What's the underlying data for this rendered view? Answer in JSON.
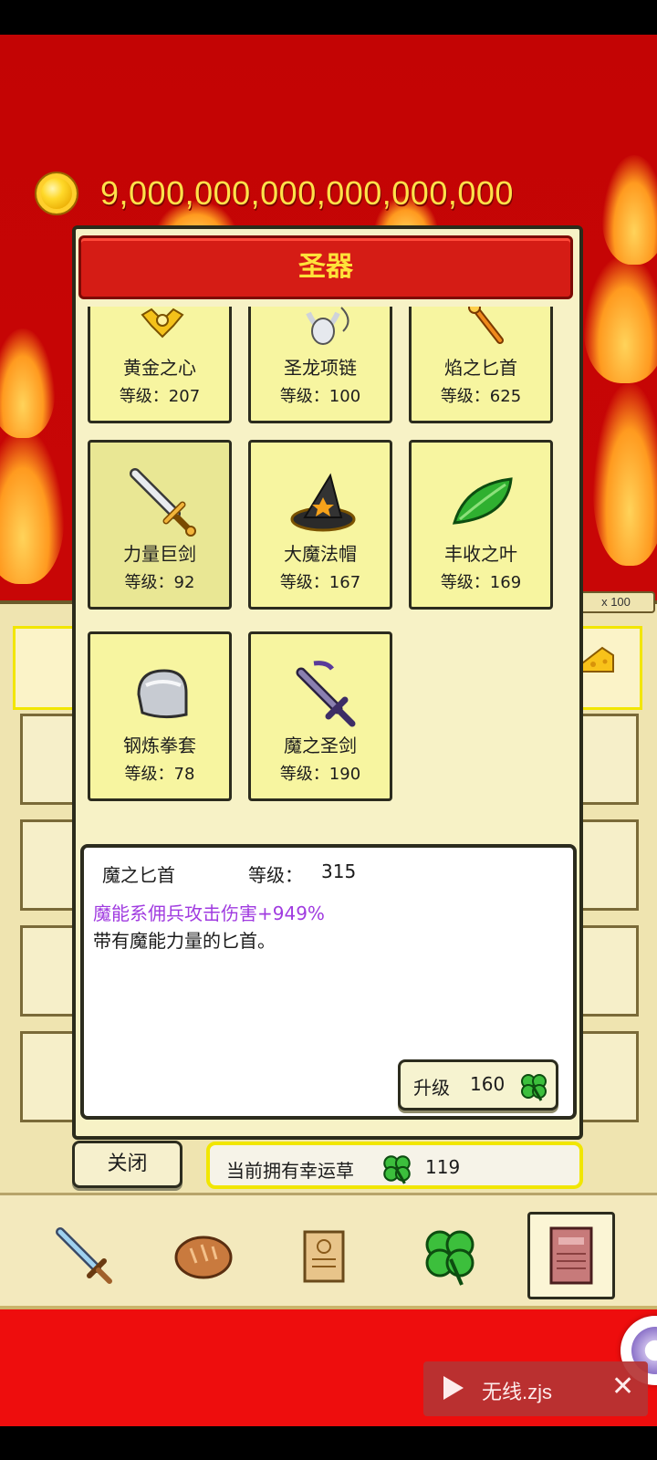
{
  "currency": {
    "amount": "9,000,000,000,000,000,000",
    "icon": "gold-coin-icon"
  },
  "dialog": {
    "title": "圣器",
    "items": [
      {
        "name": "黄金之心",
        "level": "等级：207",
        "icon": "golden-heart-icon"
      },
      {
        "name": "圣龙项链",
        "level": "等级：100",
        "icon": "dragon-necklace-icon"
      },
      {
        "name": "焰之匕首",
        "level": "等级：625",
        "icon": "flame-dagger-icon"
      },
      {
        "name": "力量巨剑",
        "level": "等级：92",
        "icon": "greatsword-icon"
      },
      {
        "name": "大魔法帽",
        "level": "等级：167",
        "icon": "wizard-hat-icon"
      },
      {
        "name": "丰收之叶",
        "level": "等级：169",
        "icon": "harvest-leaf-icon"
      },
      {
        "name": "钢炼拳套",
        "level": "等级：78",
        "icon": "steel-gauntlet-icon"
      },
      {
        "name": "魔之圣剑",
        "level": "等级：190",
        "icon": "demon-holy-sword-icon"
      }
    ],
    "detail": {
      "name": "魔之匕首",
      "level_label": "等级：",
      "level_value": "315",
      "effect": "魔能系佣兵攻击伤害+949%",
      "description": "带有魔能力量的匕首。",
      "effect_color": "#a03be0"
    },
    "upgrade": {
      "label": "升级",
      "cost": "160",
      "icon": "clover-icon"
    },
    "close_label": "关闭",
    "lucky": {
      "label": "当前拥有幸运草",
      "count": "119",
      "icon": "clover-icon"
    }
  },
  "background_panel": {
    "multiplier": "x 100"
  },
  "bottom_nav": [
    {
      "name": "sword-tab",
      "icon": "sword-icon"
    },
    {
      "name": "bread-tab",
      "icon": "bread-icon"
    },
    {
      "name": "scroll-tab",
      "icon": "scroll-icon"
    },
    {
      "name": "clover-tab",
      "icon": "clover-icon"
    },
    {
      "name": "book-tab",
      "icon": "book-icon",
      "active": true
    }
  ],
  "ad_banner": {
    "text": "无线.zjs",
    "close": "✕"
  },
  "colors": {
    "background": "#c80606",
    "title_bar": "#d51c15",
    "title_text": "#ffe23a",
    "card": "#f7f5a0",
    "currency_text": "#ffe14a"
  }
}
